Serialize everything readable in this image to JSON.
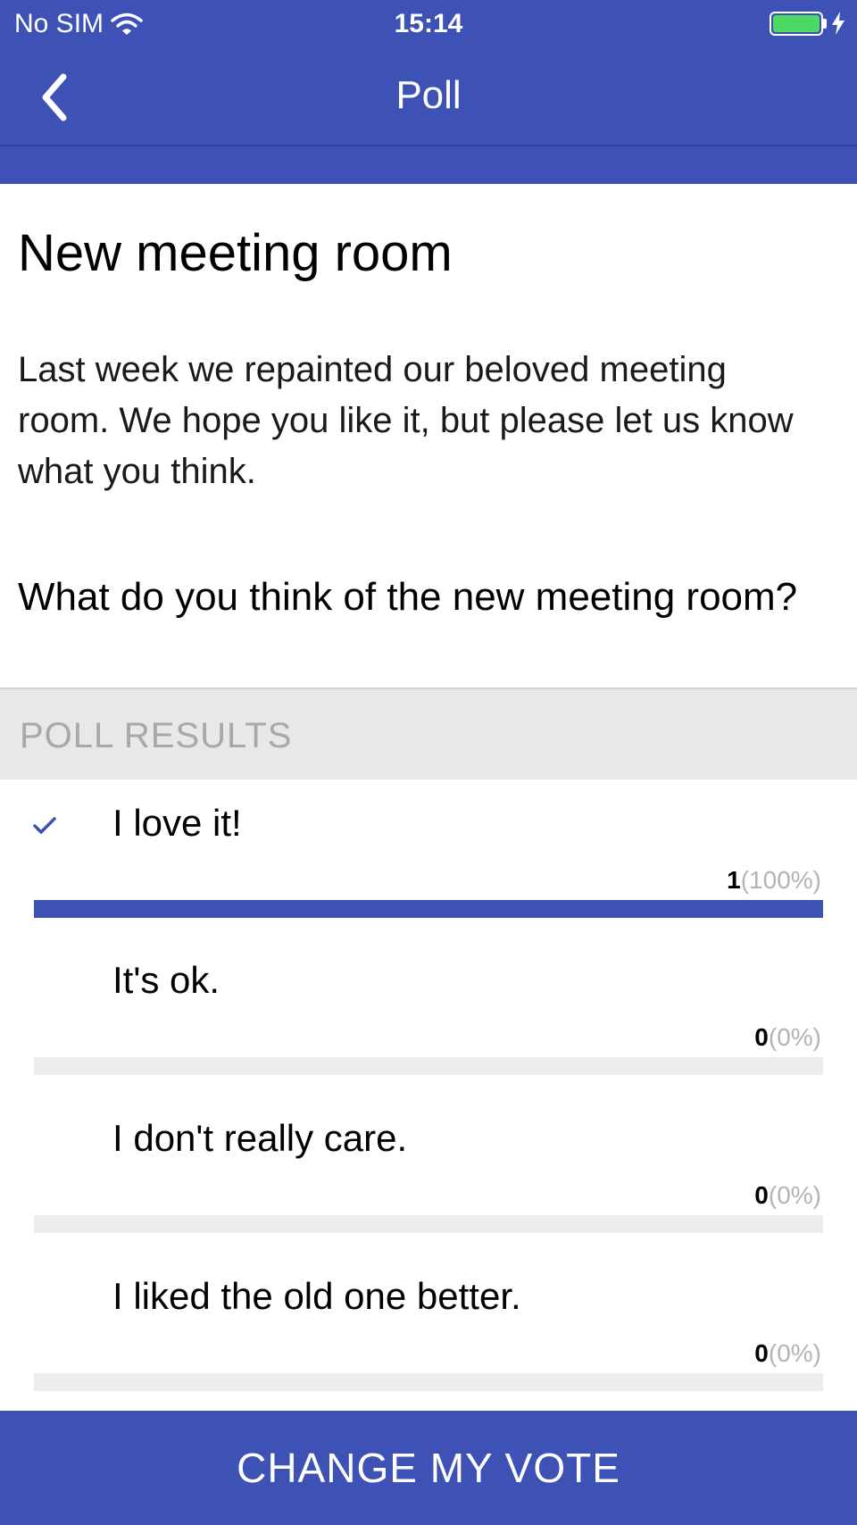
{
  "status_bar": {
    "carrier": "No SIM",
    "time": "15:14"
  },
  "nav": {
    "title": "Poll"
  },
  "poll": {
    "title": "New meeting room",
    "description": "Last week we repainted our beloved meeting room. We hope you like it, but please let us know what you think.",
    "question": "What do you think of the new meeting room?",
    "results_header": "POLL RESULTS",
    "options": [
      {
        "label": "I love it!",
        "count": "1",
        "percent": "(100%)",
        "fraction": 1.0,
        "selected": true
      },
      {
        "label": "It's ok.",
        "count": "0",
        "percent": "(0%)",
        "fraction": 0.0,
        "selected": false
      },
      {
        "label": "I don't really care.",
        "count": "0",
        "percent": "(0%)",
        "fraction": 0.0,
        "selected": false
      },
      {
        "label": "I liked the old one better.",
        "count": "0",
        "percent": "(0%)",
        "fraction": 0.0,
        "selected": false
      }
    ]
  },
  "footer": {
    "button_label": "CHANGE MY VOTE"
  },
  "colors": {
    "primary": "#3e51b5",
    "battery": "#4cd964",
    "track": "#ececec"
  },
  "icons": [
    "wifi-icon",
    "battery-icon",
    "charging-icon",
    "back-chevron-icon",
    "checkmark-icon"
  ]
}
